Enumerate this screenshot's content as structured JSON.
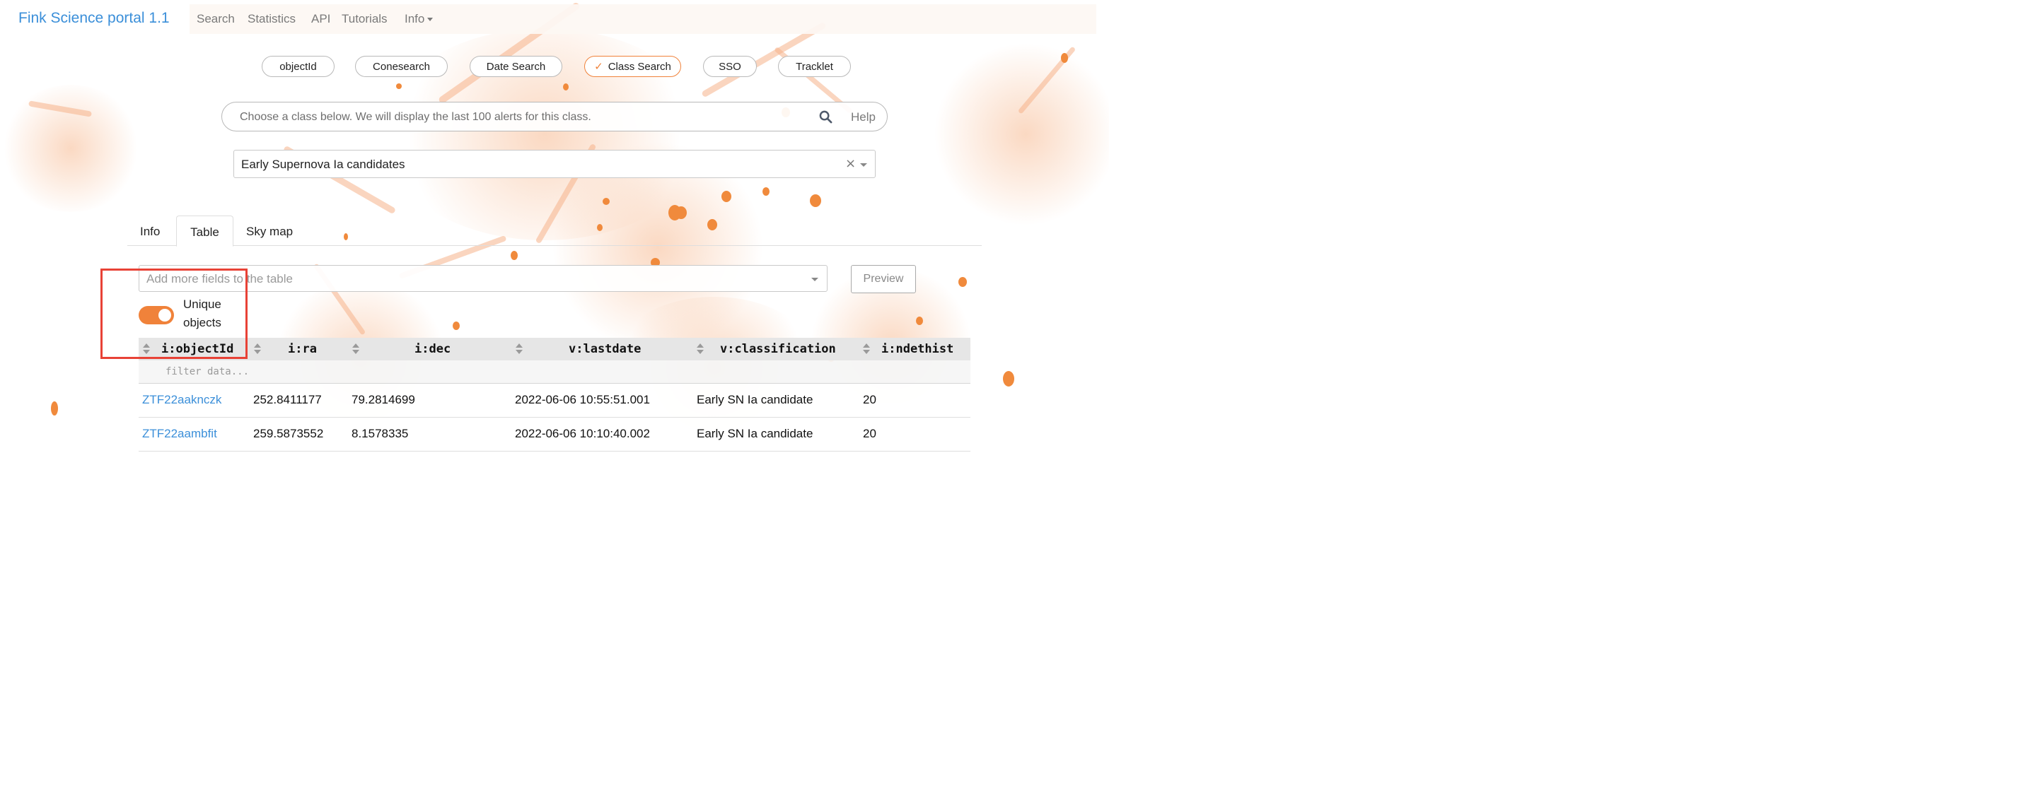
{
  "brand": "Fink Science portal 1.1",
  "nav": {
    "items": [
      "Search",
      "Statistics",
      "API",
      "Tutorials",
      "Info"
    ]
  },
  "modes": {
    "items": [
      "objectId",
      "Conesearch",
      "Date Search",
      "Class Search",
      "SSO",
      "Tracklet"
    ],
    "active": "Class Search"
  },
  "search": {
    "placeholder": "Choose a class below. We will display the last 100 alerts for this class.",
    "help_label": "Help"
  },
  "class_select": {
    "value": "Early Supernova Ia candidates",
    "clear": "×"
  },
  "tabs": [
    "Info",
    "Table",
    "Sky map"
  ],
  "active_tab": "Table",
  "fields": {
    "placeholder": "Add more fields to the table"
  },
  "preview_label": "Preview",
  "toggle": {
    "label": "Unique objects",
    "on": true
  },
  "table": {
    "columns": [
      "i:objectId",
      "i:ra",
      "i:dec",
      "v:lastdate",
      "v:classification",
      "i:ndethist"
    ],
    "filter_placeholder": "filter data...",
    "rows": [
      [
        "ZTF22aaknczk",
        "252.8411177",
        "79.2814699",
        "2022-06-06 10:55:51.001",
        "Early SN Ia candidate",
        "20"
      ],
      [
        "ZTF22aambfit",
        "259.5873552",
        "8.1578335",
        "2022-06-06 10:10:40.002",
        "Early SN Ia candidate",
        "20"
      ]
    ]
  },
  "colors": {
    "accent": "#f0823a",
    "link": "#3b8fd9",
    "annotation": "#e84236"
  }
}
